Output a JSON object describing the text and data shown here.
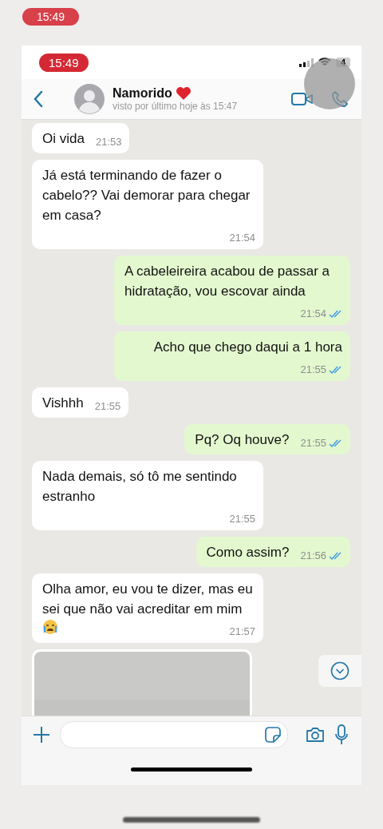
{
  "outer_status": {
    "time": "15:49"
  },
  "status_bar": {
    "time": "15:49",
    "battery": "4"
  },
  "header": {
    "name": "Namorido",
    "subtitle": "visto por último hoje às 15:47"
  },
  "messages": [
    {
      "kind": "in",
      "text": "Oi vida",
      "time": "21:53"
    },
    {
      "kind": "in",
      "text": "Já está terminando de fazer o cabelo?? Vai demorar para chegar em casa?",
      "time": "21:54"
    },
    {
      "kind": "out",
      "text": "A cabeleireira acabou de passar a hidratação, vou escovar ainda",
      "time": "21:54",
      "read": true
    },
    {
      "kind": "out",
      "text": "Acho que chego daqui a 1 hora",
      "time": "21:55",
      "read": true
    },
    {
      "kind": "in",
      "text": "Vishhh",
      "time": "21:55"
    },
    {
      "kind": "out",
      "text": "Pq? Oq houve?",
      "time": "21:55",
      "read": true
    },
    {
      "kind": "in",
      "text": "Nada demais, só tô me sentindo estranho",
      "time": "21:55"
    },
    {
      "kind": "out",
      "text": "Como assim?",
      "time": "21:56",
      "read": true
    },
    {
      "kind": "in",
      "text": "Olha amor, eu vou te dizer, mas eu sei que não vai acreditar em mim",
      "emoji": true,
      "time": "21:57"
    },
    {
      "kind": "picture"
    }
  ]
}
